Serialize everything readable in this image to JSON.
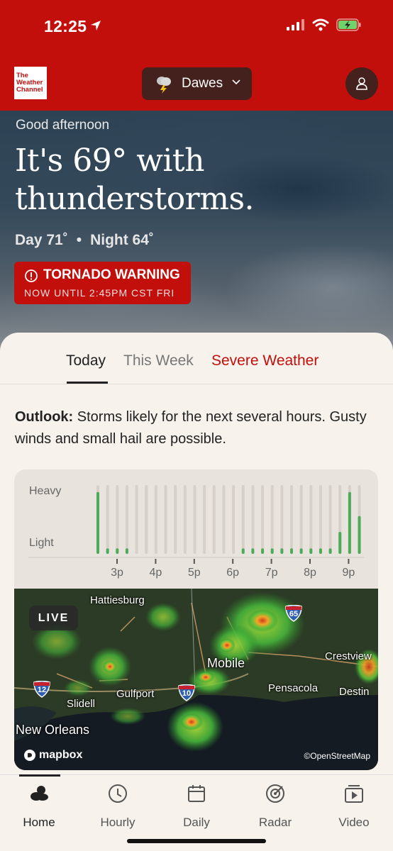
{
  "status_bar": {
    "time": "12:25",
    "battery_color": "#6ed36a"
  },
  "header": {
    "logo_text": "The Weather Channel",
    "location": "Dawes",
    "brand_color": "#c20f0c"
  },
  "hero": {
    "greeting": "Good afternoon",
    "headline": "It's 69° with thunderstorms.",
    "day": "Day 71˚",
    "separator": "•",
    "night": "Night 64˚"
  },
  "alert": {
    "title": "TORNADO WARNING",
    "subtitle": "NOW UNTIL 2:45PM CST FRI"
  },
  "tabs": [
    {
      "label": "Today",
      "active": true
    },
    {
      "label": "This Week",
      "active": false
    },
    {
      "label": "Severe Weather",
      "active": false
    }
  ],
  "outlook": {
    "label": "Outlook:",
    "text": " Storms likely for the next several hours. Gusty winds and small hail are possible."
  },
  "chart_data": {
    "type": "bar",
    "title": "",
    "ylabel_top": "Heavy",
    "ylabel_bottom": "Light",
    "x_ticks": [
      "3p",
      "4p",
      "5p",
      "6p",
      "7p",
      "8p",
      "9p"
    ],
    "bar_interval_minutes": 15,
    "values": [
      0.9,
      0.08,
      0.08,
      0.08,
      0,
      0,
      0,
      0,
      0,
      0,
      0,
      0,
      0,
      0,
      0,
      0.08,
      0.08,
      0.08,
      0.08,
      0.08,
      0.08,
      0.08,
      0.08,
      0.08,
      0.08,
      0.32,
      0.9,
      0.55
    ],
    "ylim": [
      0,
      1
    ],
    "bar_color": "#4cab58",
    "track_color": "#d6d0c9"
  },
  "map": {
    "live_label": "LIVE",
    "cities": [
      "Hattiesburg",
      "Mobile",
      "Crestview",
      "Gulfport",
      "Pensacola",
      "Destin",
      "Slidell",
      "New Orleans"
    ],
    "interstates": [
      "65",
      "12",
      "10"
    ],
    "attribution_logo": "mapbox",
    "attribution": "©OpenStreetMap"
  },
  "nav": [
    {
      "label": "Home",
      "icon": "cloud-icon",
      "active": true
    },
    {
      "label": "Hourly",
      "icon": "clock-icon",
      "active": false
    },
    {
      "label": "Daily",
      "icon": "calendar-icon",
      "active": false
    },
    {
      "label": "Radar",
      "icon": "radar-icon",
      "active": false
    },
    {
      "label": "Video",
      "icon": "video-icon",
      "active": false
    }
  ]
}
